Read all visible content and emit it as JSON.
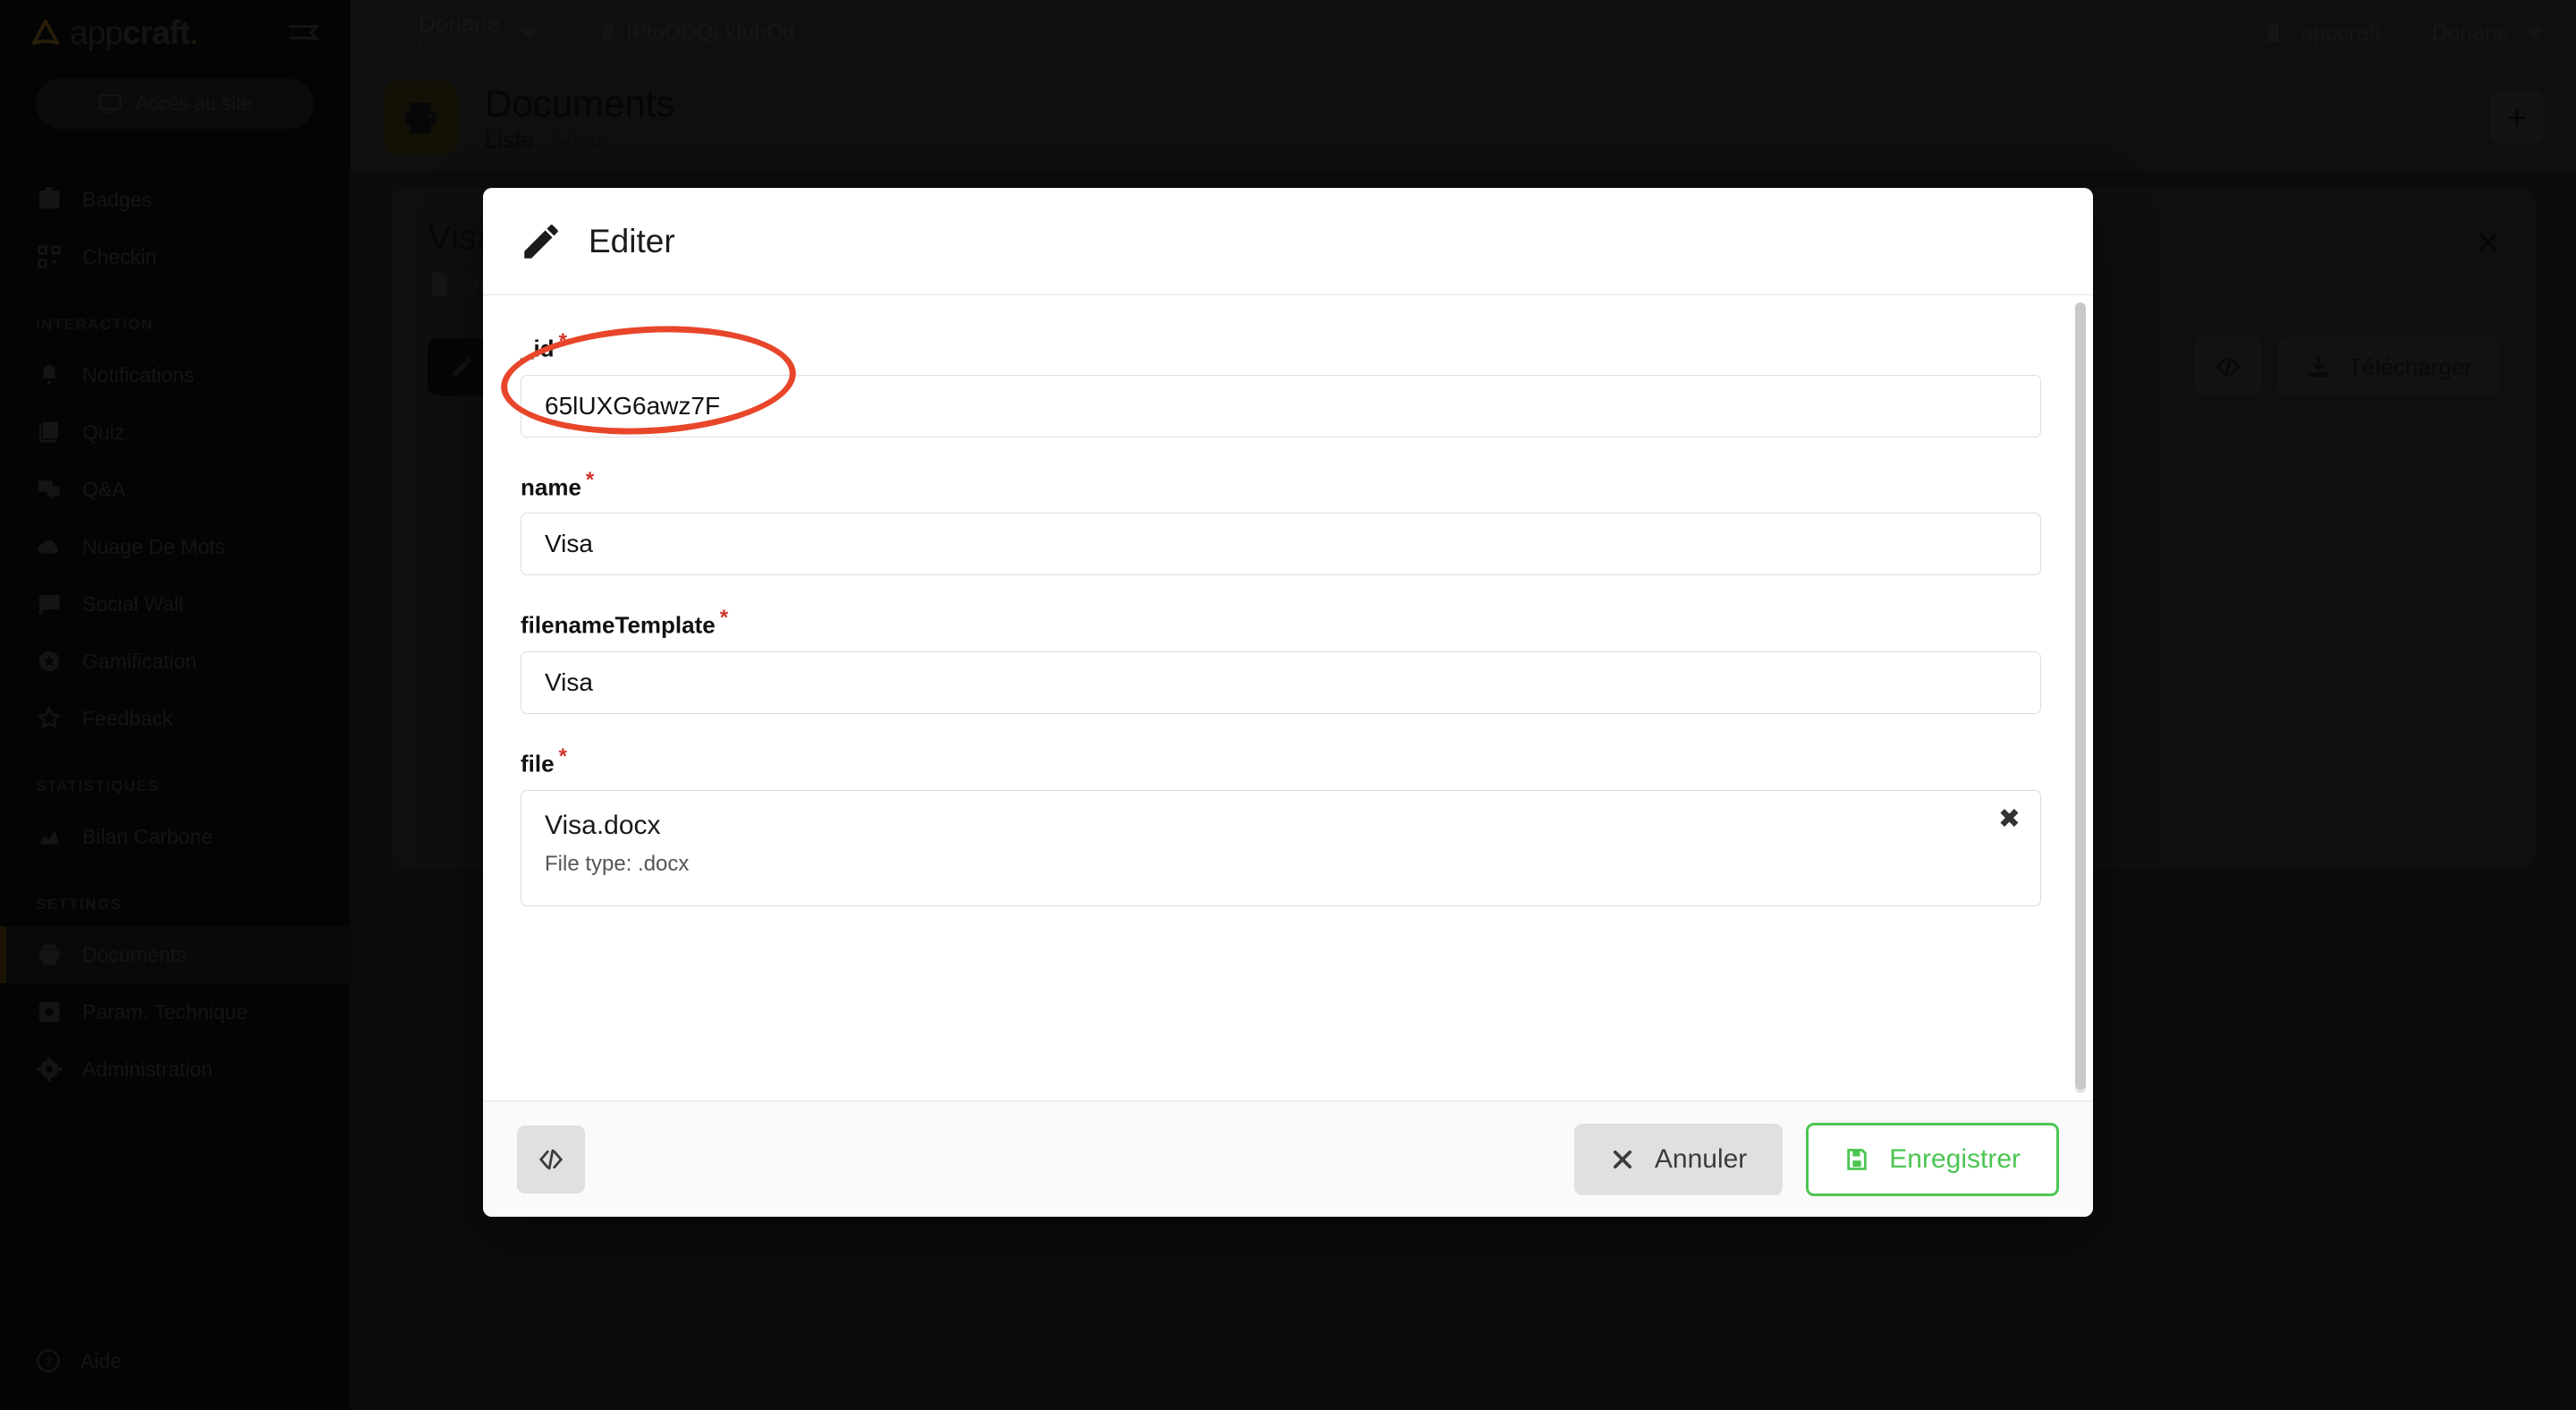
{
  "brand": {
    "name_light": "app",
    "name_bold": "craft",
    "dot": "."
  },
  "sidebar": {
    "access_button": "Accès au site",
    "groups": [
      {
        "title": "",
        "items": [
          {
            "label": "Badges",
            "icon": "badge-icon"
          },
          {
            "label": "Checkin",
            "icon": "qrcode-icon"
          }
        ]
      },
      {
        "title": "INTERACTION",
        "items": [
          {
            "label": "Notifications",
            "icon": "bell-icon"
          },
          {
            "label": "Quiz",
            "icon": "quiz-icon"
          },
          {
            "label": "Q&A",
            "icon": "chat-icon"
          },
          {
            "label": "Nuage De Mots",
            "icon": "cloud-check-icon"
          },
          {
            "label": "Social Wall",
            "icon": "image-icon"
          },
          {
            "label": "Gamification",
            "icon": "star-circle-icon"
          },
          {
            "label": "Feedback",
            "icon": "star-icon"
          }
        ]
      },
      {
        "title": "STATISTIQUES",
        "items": [
          {
            "label": "Bilan Carbone",
            "icon": "chart-area-icon"
          }
        ]
      },
      {
        "title": "SETTINGS",
        "items": [
          {
            "label": "Documents",
            "icon": "printer-icon",
            "active": true
          },
          {
            "label": "Param. Technique",
            "icon": "settings-cog-icon"
          },
          {
            "label": "Administration",
            "icon": "gear-icon"
          }
        ]
      }
    ],
    "help_label": "Aide"
  },
  "topbar": {
    "org_name": "Doriane",
    "org_sub": "Exemple",
    "hash_prefix": "#",
    "event_id": "IPtoODQLktuhOd",
    "workspace": "appcraft",
    "user": "Doriane"
  },
  "page": {
    "title": "Documents",
    "tabs": [
      {
        "label": "Liste",
        "active": true
      },
      {
        "label": "Visa",
        "active": false
      }
    ],
    "add_label": "+"
  },
  "card": {
    "title": "Visa",
    "subtitle": "Visa",
    "modify_label": "Modifier",
    "download_label": "Télécharger",
    "close_label": "✕"
  },
  "modal": {
    "title": "Editer",
    "fields": [
      {
        "key": "_id",
        "label": "_id",
        "required": true,
        "value": "65lUXG6awz7F",
        "type": "text"
      },
      {
        "key": "name",
        "label": "name",
        "required": true,
        "value": "Visa",
        "type": "text"
      },
      {
        "key": "filenameTemplate",
        "label": "filenameTemplate",
        "required": true,
        "value": "Visa",
        "type": "text"
      },
      {
        "key": "file",
        "label": "file",
        "required": true,
        "type": "file",
        "filename": "Visa.docx",
        "filetype_label": "File type: .docx",
        "remove_label": "✖"
      }
    ],
    "required_marker": "*",
    "footer": {
      "code_icon": "code-brackets-icon",
      "cancel_label": "Annuler",
      "save_label": "Enregistrer"
    }
  },
  "annotation": {
    "shape": "ellipse",
    "color": "#e8462a",
    "target": "_id"
  },
  "colors": {
    "accent_green": "#4cc552",
    "required_red": "#d0342c",
    "annotation_red": "#e8462a",
    "sidebar_bg": "#0b0b0d",
    "topbar_bg": "#222224"
  }
}
